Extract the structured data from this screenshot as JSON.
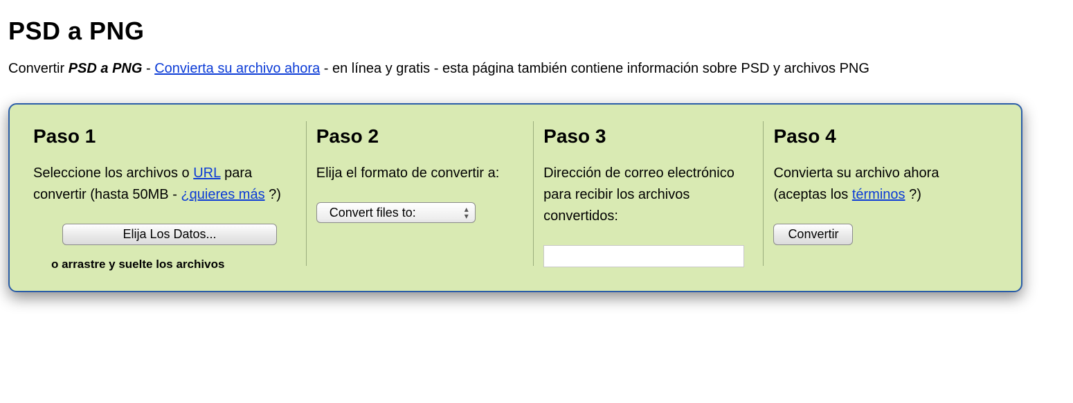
{
  "title": "PSD a PNG",
  "subtitle": {
    "pre": "Convertir ",
    "bold": "PSD a PNG",
    "sep1": " - ",
    "link": "Convierta su archivo ahora",
    "post": " - en línea y gratis - esta página también contiene información sobre PSD y archivos PNG"
  },
  "steps": {
    "s1": {
      "title": "Paso 1",
      "desc_pre": "Seleccione los archivos o ",
      "desc_link1": "URL",
      "desc_mid": " para convertir (hasta 50MB - ",
      "desc_link2": "¿quieres más",
      "desc_post": " ?)",
      "button": "Elija Los Datos...",
      "dragdrop": "o arrastre y suelte los archivos"
    },
    "s2": {
      "title": "Paso 2",
      "desc": "Elija el formato de convertir a:",
      "select_placeholder": "Convert files to:"
    },
    "s3": {
      "title": "Paso 3",
      "desc": "Dirección de correo electrónico para recibir los archivos convertidos:",
      "input_value": ""
    },
    "s4": {
      "title": "Paso 4",
      "desc_pre": "Convierta su archivo ahora (aceptas los ",
      "desc_link": "términos",
      "desc_post": " ?)",
      "button": "Convertir"
    }
  }
}
